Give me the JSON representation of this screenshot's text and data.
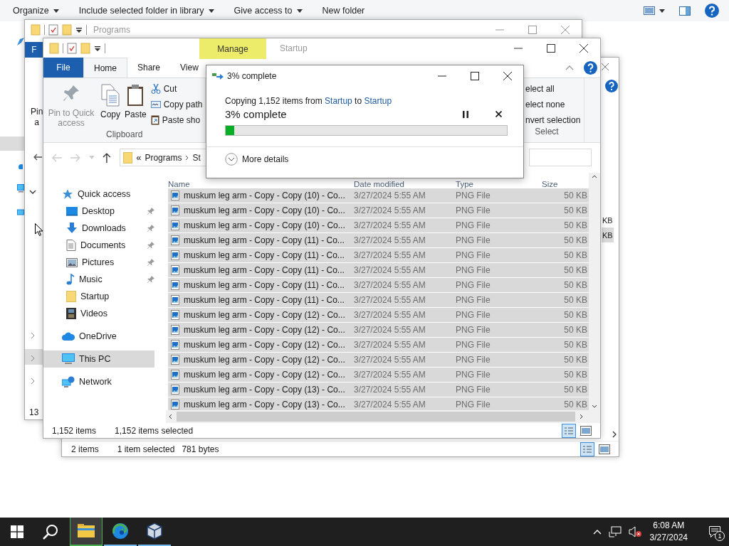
{
  "desktop_toolbar": {
    "commands": [
      {
        "label": "Organize",
        "dropdown": true
      },
      {
        "label": "Include selected folder in library",
        "dropdown": true
      },
      {
        "label": "Give access to",
        "dropdown": true
      },
      {
        "label": "New folder",
        "dropdown": false
      }
    ]
  },
  "programs_window": {
    "title": "Programs",
    "file_tab": "F",
    "pin_label": [
      "Pin",
      "a"
    ],
    "status": "13"
  },
  "back_window": {
    "size_cells": [
      {
        "text": "KB",
        "selected": false
      },
      {
        "text": "KB",
        "selected": true
      }
    ],
    "status": {
      "items": "2 items",
      "selection": "1 item selected",
      "size": "781 bytes"
    }
  },
  "startup_window": {
    "contextual_tab": "Manage",
    "title": "Startup",
    "tabs": [
      {
        "label": "File",
        "kind": "file",
        "selected": false
      },
      {
        "label": "Home",
        "kind": "tab",
        "selected": true
      },
      {
        "label": "Share",
        "kind": "tab",
        "selected": false
      },
      {
        "label": "View",
        "kind": "tab",
        "selected": false
      }
    ],
    "clipboard": {
      "large": [
        {
          "label": "Pin to Quick access",
          "kind": "pin",
          "disabled": true
        },
        {
          "label": "Copy",
          "kind": "copy",
          "disabled": false
        },
        {
          "label": "Paste",
          "kind": "paste",
          "disabled": false
        }
      ],
      "small": [
        {
          "label": "Cut",
          "kind": "cut"
        },
        {
          "label": "Copy path",
          "kind": "path"
        },
        {
          "label": "Paste sho",
          "kind": "shortcut"
        }
      ],
      "group": "Clipboard"
    },
    "select_group": {
      "items": [
        "elect all",
        "elect none",
        "nvert selection"
      ],
      "group": "Select"
    },
    "address": {
      "prefix": "«",
      "parts": [
        "Programs",
        "St"
      ]
    },
    "navigation": [
      {
        "label": "Quick access",
        "kind": "star",
        "selected": false,
        "children": [
          {
            "label": "Desktop",
            "kind": "desktop",
            "pinned": true,
            "selected": false
          },
          {
            "label": "Downloads",
            "kind": "download",
            "pinned": true,
            "selected": false
          },
          {
            "label": "Documents",
            "kind": "document",
            "pinned": true,
            "selected": false
          },
          {
            "label": "Pictures",
            "kind": "pictures",
            "pinned": true,
            "selected": false
          },
          {
            "label": "Music",
            "kind": "music",
            "pinned": true,
            "selected": false
          },
          {
            "label": "Startup",
            "kind": "folder",
            "pinned": false,
            "selected": false
          },
          {
            "label": "Videos",
            "kind": "video",
            "pinned": false,
            "selected": false
          }
        ]
      },
      {
        "label": "OneDrive",
        "kind": "cloud",
        "selected": false
      },
      {
        "label": "This PC",
        "kind": "pc",
        "selected": true
      },
      {
        "label": "Network",
        "kind": "network",
        "selected": false
      }
    ],
    "columns": [
      "Name",
      "Date modified",
      "Type",
      "Size"
    ],
    "rows": [
      {
        "name": "muskum leg arm - Copy - Copy (10) - Co...",
        "date": "3/27/2024 5:55 AM",
        "type": "PNG File",
        "size": "50 KB",
        "selected": true
      },
      {
        "name": "muskum leg arm - Copy - Copy (10) - Co...",
        "date": "3/27/2024 5:55 AM",
        "type": "PNG File",
        "size": "50 KB",
        "selected": true
      },
      {
        "name": "muskum leg arm - Copy - Copy (10) - Co...",
        "date": "3/27/2024 5:55 AM",
        "type": "PNG File",
        "size": "50 KB",
        "selected": true
      },
      {
        "name": "muskum leg arm - Copy - Copy (11) - Co...",
        "date": "3/27/2024 5:55 AM",
        "type": "PNG File",
        "size": "50 KB",
        "selected": true
      },
      {
        "name": "muskum leg arm - Copy - Copy (11) - Co...",
        "date": "3/27/2024 5:55 AM",
        "type": "PNG File",
        "size": "50 KB",
        "selected": true
      },
      {
        "name": "muskum leg arm - Copy - Copy (11) - Co...",
        "date": "3/27/2024 5:55 AM",
        "type": "PNG File",
        "size": "50 KB",
        "selected": true
      },
      {
        "name": "muskum leg arm - Copy - Copy (11) - Co...",
        "date": "3/27/2024 5:55 AM",
        "type": "PNG File",
        "size": "50 KB",
        "selected": true
      },
      {
        "name": "muskum leg arm - Copy - Copy (11) - Co...",
        "date": "3/27/2024 5:55 AM",
        "type": "PNG File",
        "size": "50 KB",
        "selected": true
      },
      {
        "name": "muskum leg arm - Copy - Copy (12) - Co...",
        "date": "3/27/2024 5:55 AM",
        "type": "PNG File",
        "size": "50 KB",
        "selected": true
      },
      {
        "name": "muskum leg arm - Copy - Copy (12) - Co...",
        "date": "3/27/2024 5:55 AM",
        "type": "PNG File",
        "size": "50 KB",
        "selected": true
      },
      {
        "name": "muskum leg arm - Copy - Copy (12) - Co...",
        "date": "3/27/2024 5:55 AM",
        "type": "PNG File",
        "size": "50 KB",
        "selected": true
      },
      {
        "name": "muskum leg arm - Copy - Copy (12) - Co...",
        "date": "3/27/2024 5:55 AM",
        "type": "PNG File",
        "size": "50 KB",
        "selected": true
      },
      {
        "name": "muskum leg arm - Copy - Copy (12) - Co...",
        "date": "3/27/2024 5:55 AM",
        "type": "PNG File",
        "size": "50 KB",
        "selected": true
      },
      {
        "name": "muskum leg arm - Copy - Copy (13) - Co...",
        "date": "3/27/2024 5:55 AM",
        "type": "PNG File",
        "size": "50 KB",
        "selected": true
      },
      {
        "name": "muskum leg arm - Copy - Copy (13) - Co...",
        "date": "3/27/2024 5:55 AM",
        "type": "PNG File",
        "size": "50 KB",
        "selected": true
      }
    ],
    "status": {
      "items": "1,152 items",
      "selection": "1,152 items selected"
    }
  },
  "copy_dialog": {
    "title": "3% complete",
    "message": {
      "prefix": "Copying 1,152 items from",
      "source": "Startup",
      "middle": "to",
      "destination": "Startup"
    },
    "progress_text": "3% complete",
    "level": 0.03,
    "details": "More details"
  },
  "taskbar": {
    "apps": [
      {
        "kind": "explorer",
        "active": true
      },
      {
        "kind": "edge",
        "active": false
      },
      {
        "kind": "box",
        "active": false
      }
    ],
    "time": "6:08 AM",
    "date": "3/27/2024",
    "notifications": "1"
  }
}
